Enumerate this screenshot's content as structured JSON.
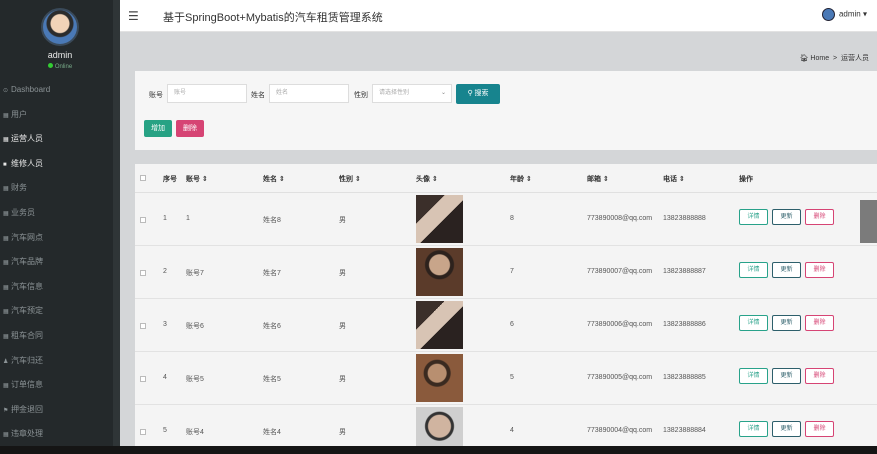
{
  "sidebar": {
    "username": "admin",
    "status": "Online",
    "items": [
      {
        "label": "Dashboard",
        "icon": "⊙"
      },
      {
        "label": "用户",
        "icon": "▦"
      },
      {
        "label": "运营人员",
        "icon": "▦"
      },
      {
        "label": "维修人员",
        "icon": "■"
      },
      {
        "label": "财务",
        "icon": "▦"
      },
      {
        "label": "业务员",
        "icon": "▦"
      },
      {
        "label": "汽车网点",
        "icon": "▦"
      },
      {
        "label": "汽车品牌",
        "icon": "▦"
      },
      {
        "label": "汽车信息",
        "icon": "▦"
      },
      {
        "label": "汽车预定",
        "icon": "▦"
      },
      {
        "label": "租车合同",
        "icon": "▦"
      },
      {
        "label": "汽车归还",
        "icon": "♟"
      },
      {
        "label": "订单信息",
        "icon": "▦"
      },
      {
        "label": "押金退回",
        "icon": "⚑"
      },
      {
        "label": "违章处理",
        "icon": "▦"
      }
    ]
  },
  "header": {
    "title": "基于SpringBoot+Mybatis的汽车租赁管理系统",
    "user": "admin"
  },
  "breadcrumb": {
    "home": "Home",
    "current": "运营人员"
  },
  "search": {
    "account_label": "账号",
    "account_placeholder": "账号",
    "name_label": "姓名",
    "name_placeholder": "姓名",
    "gender_label": "性别",
    "gender_placeholder": "请选择性别",
    "search_button": "搜索",
    "add_button": "增加",
    "delete_button": "删除"
  },
  "table": {
    "headers": [
      "序号",
      "账号 ⇕",
      "姓名 ⇕",
      "性别 ⇕",
      "头像 ⇕",
      "年龄 ⇕",
      "邮箱 ⇕",
      "电话 ⇕",
      "操作"
    ],
    "action_labels": {
      "detail": "详情",
      "update": "更新",
      "delete": "删除"
    },
    "rows": [
      {
        "index": "1",
        "account": "1",
        "name": "姓名8",
        "gender": "男",
        "photo": "girl",
        "age": "8",
        "email": "773890008@qq.com",
        "phone": "13823888888"
      },
      {
        "index": "2",
        "account": "账号7",
        "name": "姓名7",
        "gender": "男",
        "photo": "boy1",
        "age": "7",
        "email": "773890007@qq.com",
        "phone": "13823888887"
      },
      {
        "index": "3",
        "account": "账号6",
        "name": "姓名6",
        "gender": "男",
        "photo": "girl",
        "age": "6",
        "email": "773890006@qq.com",
        "phone": "13823888886"
      },
      {
        "index": "4",
        "account": "账号5",
        "name": "姓名5",
        "gender": "男",
        "photo": "boy2",
        "age": "5",
        "email": "773890005@qq.com",
        "phone": "13823888885"
      },
      {
        "index": "5",
        "account": "账号4",
        "name": "姓名4",
        "gender": "男",
        "photo": "boy3",
        "age": "4",
        "email": "773890004@qq.com",
        "phone": "13823888884"
      }
    ]
  }
}
